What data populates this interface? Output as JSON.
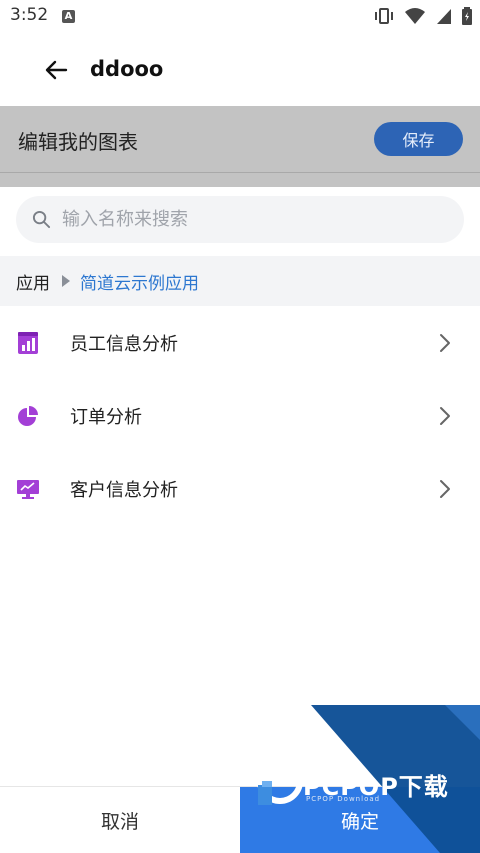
{
  "status_bar": {
    "time": "3:52",
    "notification_letter": "A"
  },
  "app_bar": {
    "title": "ddooo"
  },
  "header": {
    "title": "编辑我的图表",
    "save_label": "保存"
  },
  "search": {
    "placeholder": "输入名称来搜索",
    "value": ""
  },
  "breadcrumb": {
    "root": "应用",
    "current": "简道云示例应用"
  },
  "items": [
    {
      "label": "员工信息分析",
      "icon": "bar-chart-icon"
    },
    {
      "label": "订单分析",
      "icon": "pie-chart-icon"
    },
    {
      "label": "客户信息分析",
      "icon": "monitor-chart-icon"
    }
  ],
  "footer": {
    "cancel_label": "取消",
    "confirm_label": "确定"
  },
  "watermark": {
    "text": "PCPOP下载",
    "sub": "PCPOP Download"
  },
  "colors": {
    "accent": "#2f7ae5",
    "save_button": "#2d64b5",
    "icon_purple": "#a33fd6",
    "link_blue": "#2d77d0"
  }
}
